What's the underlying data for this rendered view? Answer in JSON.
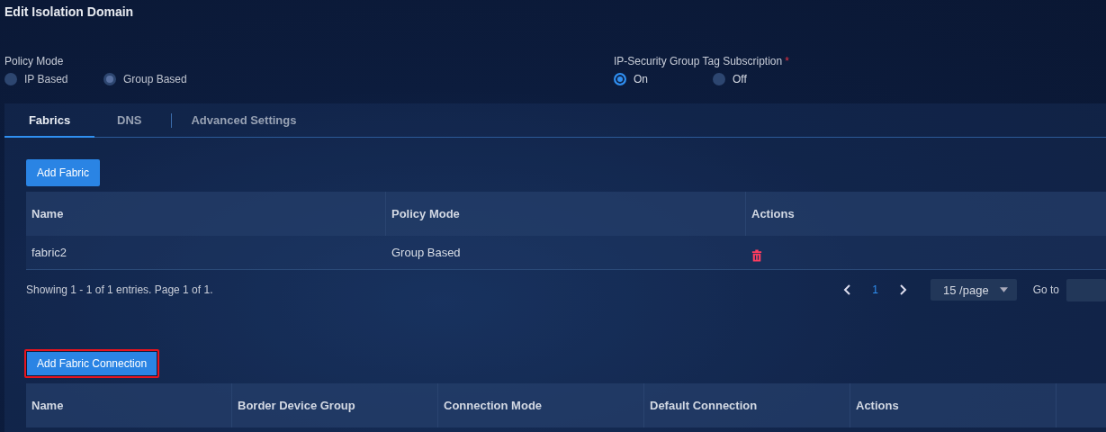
{
  "title": "Edit Isolation Domain",
  "policy_mode": {
    "label": "Policy Mode",
    "disabled": true,
    "options": [
      {
        "label": "IP Based",
        "selected": false
      },
      {
        "label": "Group Based",
        "selected": true
      }
    ]
  },
  "sgt_subscription": {
    "label": "IP-Security Group Tag Subscription",
    "required_mark": "*",
    "options": [
      {
        "label": "On",
        "selected": true
      },
      {
        "label": "Off",
        "selected": false
      }
    ]
  },
  "tabs": [
    {
      "label": "Fabrics",
      "selected": true
    },
    {
      "label": "DNS",
      "selected": false
    },
    {
      "label": "Advanced Settings",
      "selected": false
    }
  ],
  "fabrics": {
    "add_button": "Add Fabric",
    "columns": [
      "Name",
      "Policy Mode",
      "Actions"
    ],
    "rows": [
      {
        "cells": [
          "fabric2",
          "Group Based"
        ],
        "deletable": true
      }
    ],
    "summary": "Showing 1 - 1 of 1 entries. Page 1 of 1.",
    "pages": [
      {
        "label": "1",
        "selected": true
      }
    ],
    "page_size": "15 /page",
    "goto_label": "Go to"
  },
  "connections": {
    "add_button": {
      "label": "Add Fabric Connection",
      "highlighted": true
    },
    "columns": [
      "Name",
      "Border Device Group",
      "Connection Mode",
      "Default Connection",
      "Actions"
    ]
  }
}
